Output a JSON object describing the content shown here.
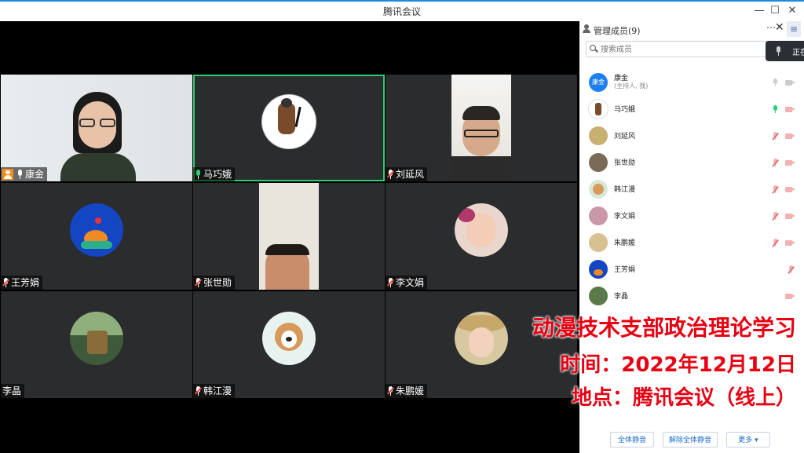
{
  "window": {
    "title": "腾讯会议"
  },
  "participants_grid": [
    {
      "name": "康金",
      "host": true
    },
    {
      "name": "马巧娥",
      "speaking": true
    },
    {
      "name": "刘延风",
      "muted": true
    },
    {
      "name": "王芳娟",
      "muted": true
    },
    {
      "name": "张世勋",
      "muted": true
    },
    {
      "name": "李文娟",
      "muted": true
    },
    {
      "name": "李晶",
      "muted": false
    },
    {
      "name": "韩江漫",
      "muted": true
    },
    {
      "name": "朱鹏媛",
      "muted": true
    }
  ],
  "panel": {
    "title": "管理成员(9)",
    "search_placeholder": "搜索成员",
    "tooltip": "正在",
    "members": [
      {
        "name": "康金",
        "role": "(主持人, 我)",
        "avatar_text": "康金",
        "mic": "idle",
        "cam": "idle"
      },
      {
        "name": "马巧娥",
        "mic": "on",
        "cam": "off"
      },
      {
        "name": "刘延风",
        "mic": "off",
        "cam": "off"
      },
      {
        "name": "张世勋",
        "mic": "off",
        "cam": "off"
      },
      {
        "name": "韩江漫",
        "mic": "off",
        "cam": "off"
      },
      {
        "name": "李文娟",
        "mic": "off",
        "cam": "off"
      },
      {
        "name": "朱鹏媛",
        "mic": "off",
        "cam": "off"
      },
      {
        "name": "王芳娟",
        "mic": "off",
        "cam": "none"
      },
      {
        "name": "李晶",
        "mic": "none",
        "cam": "off"
      }
    ],
    "buttons": {
      "mute_all": "全体静音",
      "unmute_all": "解除全体静音",
      "more": "更多 ▾"
    }
  },
  "overlay": {
    "line1": "动漫技术支部政治理论学习",
    "line2": "时间：2022年12月12日",
    "line3": "地点：腾讯会议（线上）"
  },
  "colors": {
    "accent": "#1e88e5",
    "overlay_text": "#e60012",
    "active_border": "#2ecc71"
  }
}
